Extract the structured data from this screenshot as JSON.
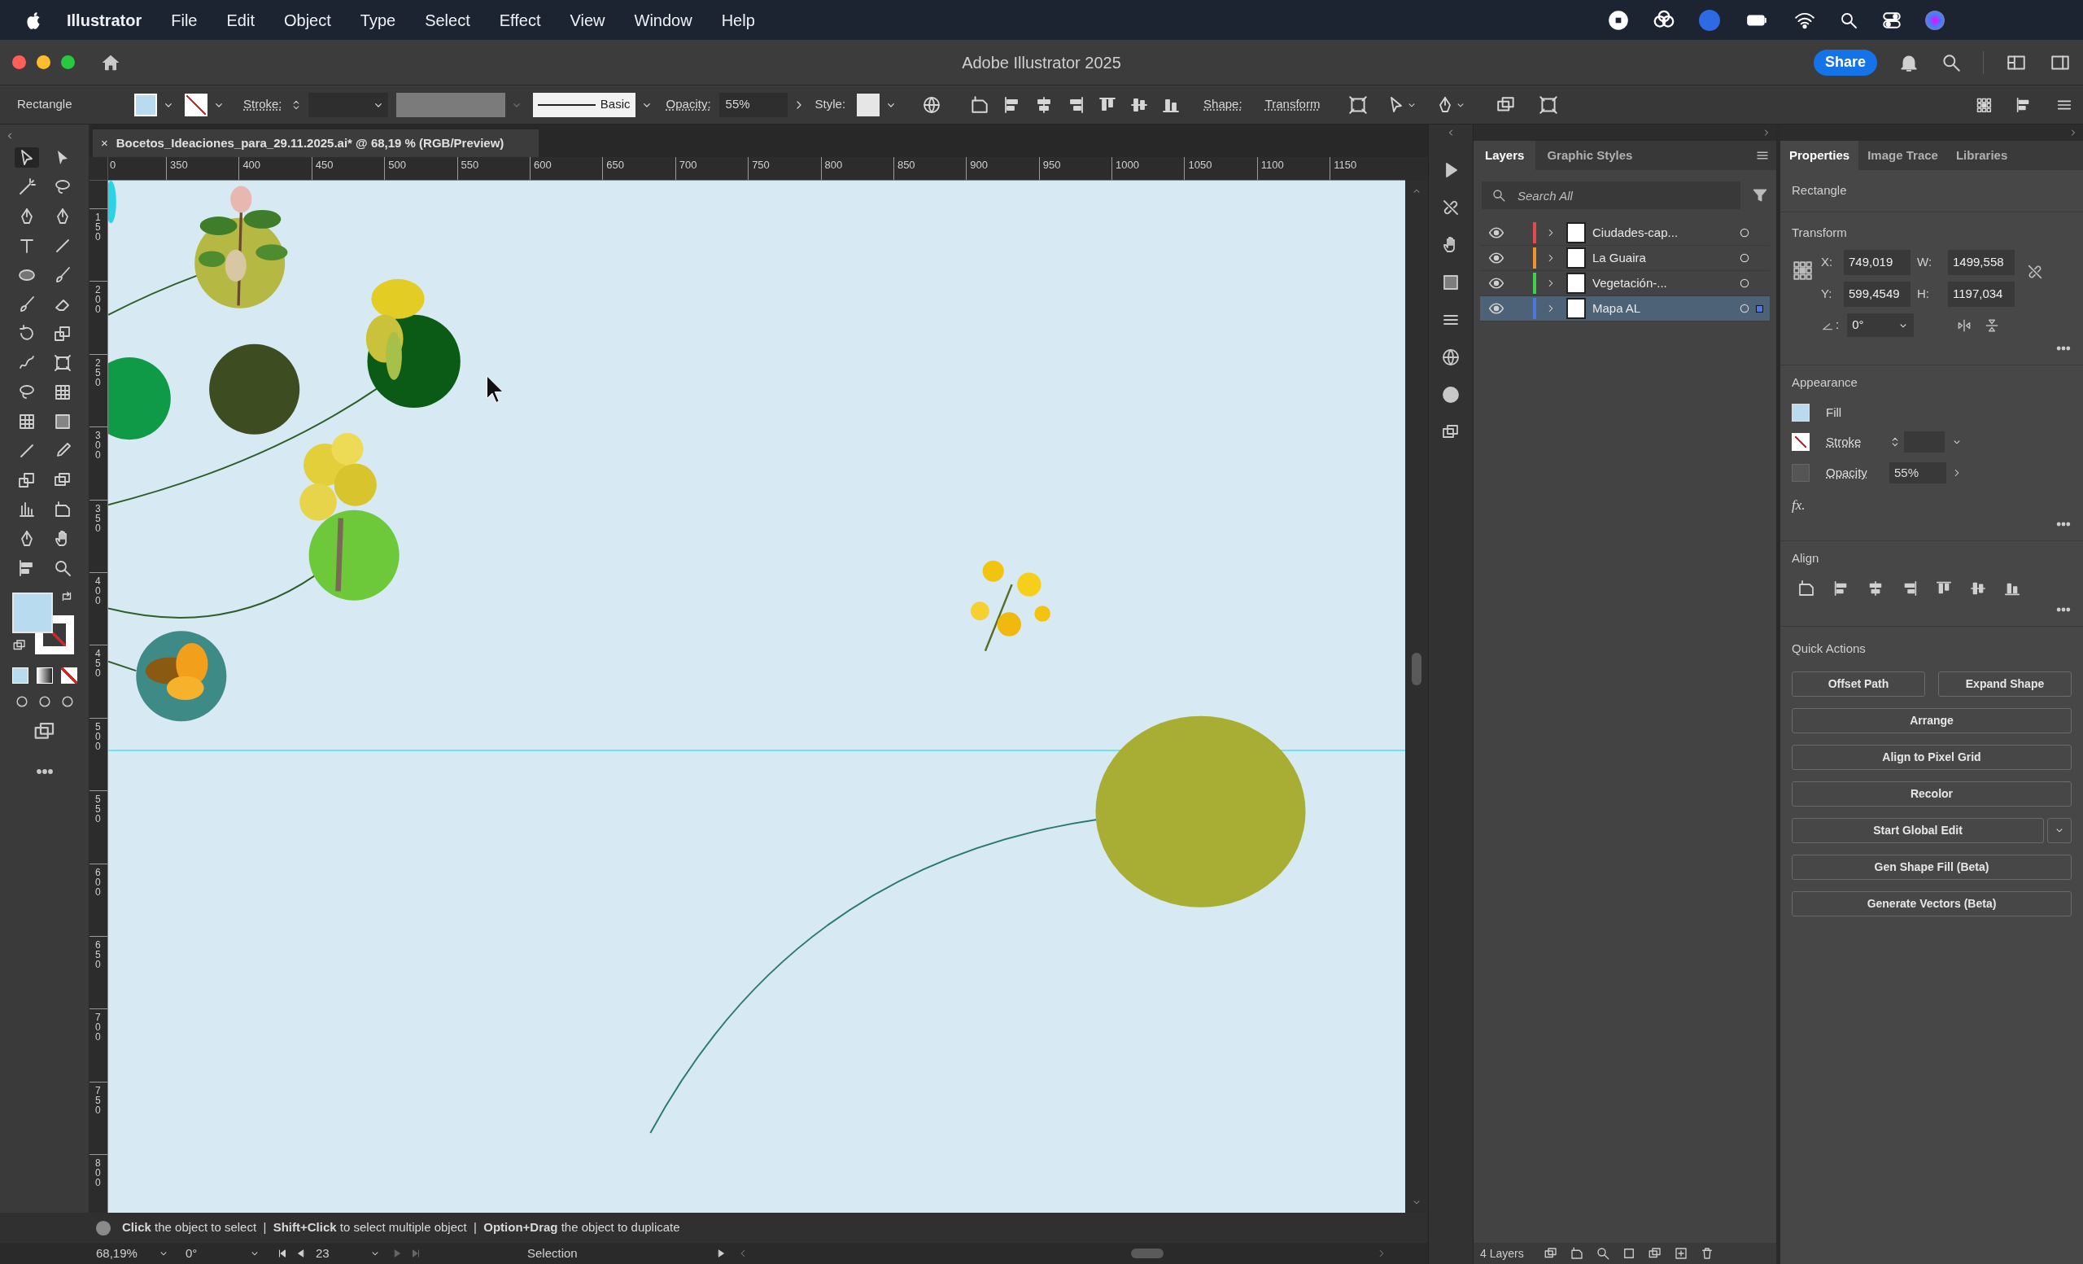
{
  "menu_bar": {
    "app_name": "Illustrator",
    "items": [
      "File",
      "Edit",
      "Object",
      "Type",
      "Select",
      "Effect",
      "View",
      "Window",
      "Help"
    ]
  },
  "window": {
    "title": "Adobe Illustrator 2025",
    "share_button": "Share"
  },
  "control_bar": {
    "object_type": "Rectangle",
    "stroke_label": "Stroke:",
    "stroke_profile": "Basic",
    "opacity_label": "Opacity:",
    "opacity_value": "55%",
    "style_label": "Style:",
    "shape_label": "Shape:",
    "transform_button": "Transform"
  },
  "document_tab": {
    "close": "×",
    "title": "Bocetos_Ideaciones_para_29.11.2025.ai* @ 68,19 % (RGB/Preview)"
  },
  "rulers": {
    "horizontal": [
      "0",
      "350",
      "400",
      "450",
      "500",
      "550",
      "600",
      "650",
      "700",
      "750",
      "800",
      "850",
      "900",
      "950",
      "1000",
      "1050",
      "1100",
      "1150"
    ],
    "vertical": [
      "150",
      "200",
      "250",
      "300",
      "350",
      "400",
      "450",
      "500",
      "550",
      "600",
      "650",
      "700",
      "750",
      "800"
    ]
  },
  "layers_panel": {
    "tabs": [
      {
        "label": "Layers",
        "selected": true
      },
      {
        "label": "Graphic Styles",
        "selected": false
      }
    ],
    "search": {
      "placeholder": "Search All"
    },
    "layers": [
      {
        "name": "Ciudades-cap...",
        "color": "#e5484d",
        "visible": true,
        "selected": false
      },
      {
        "name": "La Guaira",
        "color": "#f0932b",
        "visible": true,
        "selected": false
      },
      {
        "name": "Vegetación-...",
        "color": "#3fd14a",
        "visible": true,
        "selected": false
      },
      {
        "name": "Mapa AL",
        "color": "#4a78e0",
        "visible": true,
        "selected": true
      }
    ],
    "footer": "4 Layers"
  },
  "properties_panel": {
    "tabs": [
      {
        "label": "Properties",
        "selected": true
      },
      {
        "label": "Image Trace",
        "selected": false
      },
      {
        "label": "Libraries",
        "selected": false
      }
    ],
    "selection": "Rectangle",
    "transform": {
      "title": "Transform",
      "fields": [
        {
          "label": "X:",
          "value": "749,019"
        },
        {
          "label": "W:",
          "value": "1499,558"
        },
        {
          "label": "Y:",
          "value": "599,4549"
        },
        {
          "label": "H:",
          "value": "1197,034"
        }
      ],
      "angle_label": ":",
      "angle": "0°"
    },
    "appearance": {
      "title": "Appearance",
      "fill_label": "Fill",
      "stroke_label": "Stroke",
      "opacity_label": "Opacity",
      "opacity_value": "55%",
      "effects": "fx."
    },
    "align": {
      "title": "Align"
    },
    "quick_actions": {
      "title": "Quick Actions",
      "buttons": [
        {
          "label": "Offset Path",
          "kind": "half"
        },
        {
          "label": "Expand Shape",
          "kind": "half"
        },
        {
          "label": "Arrange",
          "kind": "full"
        },
        {
          "label": "Align to Pixel Grid",
          "kind": "full"
        },
        {
          "label": "Recolor",
          "kind": "full"
        },
        {
          "label": "Start Global Edit",
          "kind": "dropdown"
        },
        {
          "label": "Gen Shape Fill (Beta)",
          "kind": "full"
        },
        {
          "label": "Generate Vectors (Beta)",
          "kind": "full"
        }
      ]
    }
  },
  "status_bar": {
    "hint": "**Click** the object to select  |  **Shift+Click** to select multiple object  |  **Option+Drag** the object to duplicate",
    "zoom": "68,19%",
    "rotation": "0°",
    "artboard": "23",
    "tool": "Selection"
  }
}
